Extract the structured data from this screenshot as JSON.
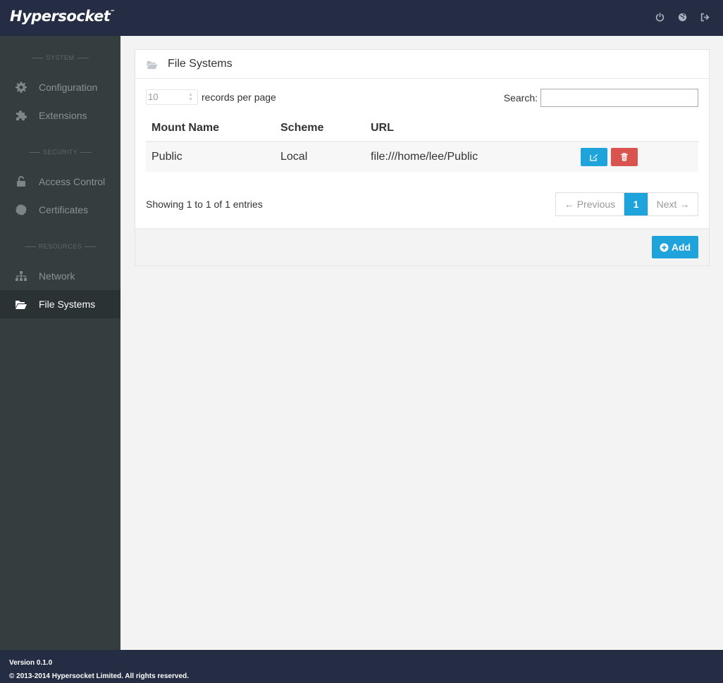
{
  "app": {
    "logo": "Hypersocket",
    "logo_mark": "™"
  },
  "topbar": {
    "icons": [
      "power-icon",
      "globe-icon",
      "sign-out-icon"
    ]
  },
  "sidebar": {
    "sections": [
      {
        "label": "SYSTEM"
      },
      {
        "label": "SECURITY"
      },
      {
        "label": "RESOURCES"
      }
    ],
    "items": [
      {
        "label": "Configuration",
        "icon": "gear-icon"
      },
      {
        "label": "Extensions",
        "icon": "puzzle-icon"
      },
      {
        "label": "Access Control",
        "icon": "unlock-icon"
      },
      {
        "label": "Certificates",
        "icon": "certificate-icon"
      },
      {
        "label": "Network",
        "icon": "sitemap-icon"
      },
      {
        "label": "File Systems",
        "icon": "folder-open-icon",
        "active": true
      }
    ]
  },
  "panel": {
    "title": "File Systems",
    "records_per_page": {
      "value": "10",
      "label": "records per page"
    },
    "search": {
      "label": "Search:",
      "value": ""
    },
    "columns": [
      "Mount Name",
      "Scheme",
      "URL"
    ],
    "rows": [
      {
        "mount_name": "Public",
        "scheme": "Local",
        "url": "file:///home/lee/Public"
      }
    ],
    "info": "Showing 1 to 1 of 1 entries",
    "pagination": {
      "previous": "← Previous",
      "current": "1",
      "next": "Next →"
    },
    "add_label": "Add"
  },
  "colors": {
    "navbar": "#242d44",
    "sidebar": "#353d3f",
    "accent": "#1ea3da",
    "danger": "#d9534f"
  },
  "footer": {
    "version": "Version 0.1.0",
    "copyright": "© 2013-2014 Hypersocket Limited. All rights reserved."
  }
}
